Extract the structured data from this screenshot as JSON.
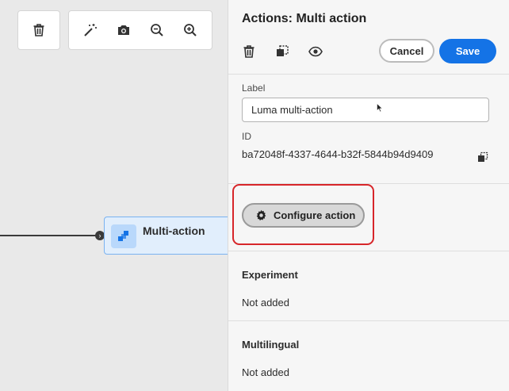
{
  "canvas": {
    "node": {
      "label": "Multi-action",
      "icon": "multi-action-icon"
    },
    "toolbar_left": [
      {
        "icon": "trash-icon"
      }
    ],
    "toolbar_right": [
      {
        "icon": "magic-wand-icon"
      },
      {
        "icon": "camera-icon"
      },
      {
        "icon": "zoom-out-icon"
      },
      {
        "icon": "zoom-in-icon"
      }
    ]
  },
  "panel": {
    "title": "Actions: Multi action",
    "cancel_label": "Cancel",
    "save_label": "Save",
    "label_caption": "Label",
    "label_value": "Luma multi-action",
    "id_caption": "ID",
    "id_value": "ba72048f-4337-4644-b32f-5844b94d9409",
    "configure_label": "Configure action",
    "experiment": {
      "title": "Experiment",
      "value": "Not added"
    },
    "multilingual": {
      "title": "Multilingual",
      "value": "Not added"
    }
  },
  "colors": {
    "accent": "#1473e6",
    "highlight": "#d7262a",
    "node_bg": "#e1eefc"
  }
}
